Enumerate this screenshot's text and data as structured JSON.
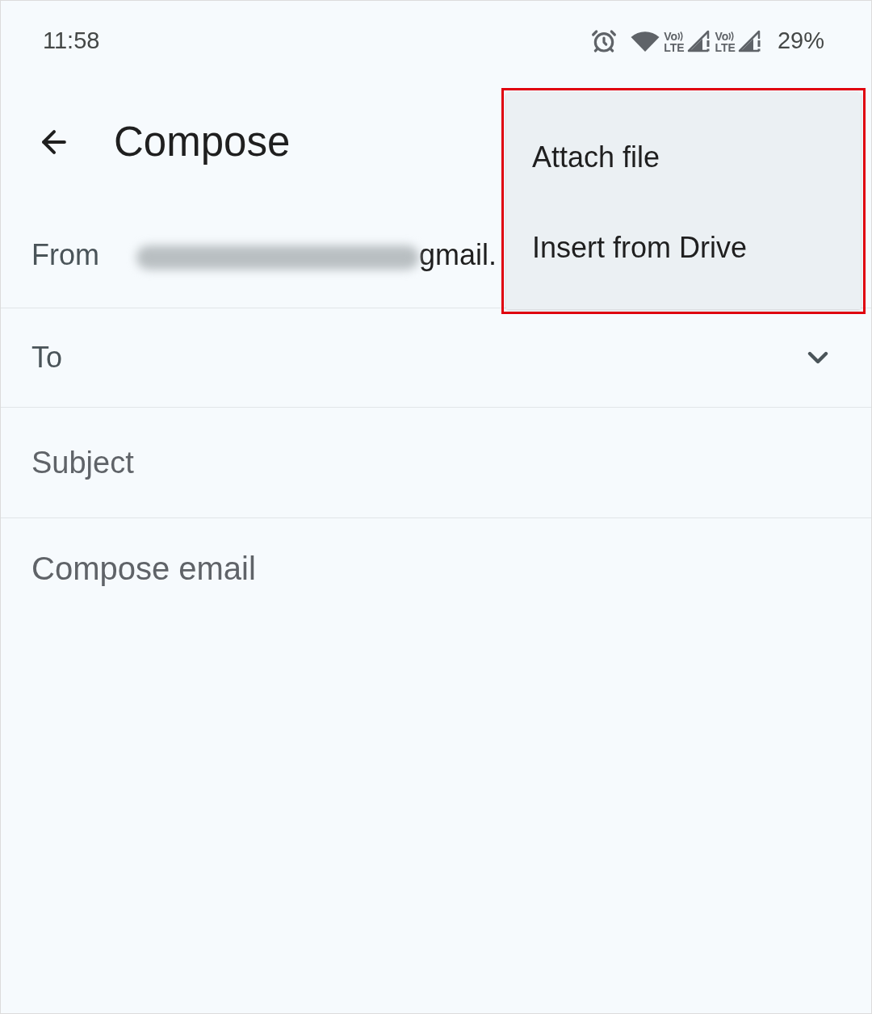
{
  "status_bar": {
    "time": "11:58",
    "sims": [
      {
        "volte_top": "Vo",
        "volte_bottom": "LTE"
      },
      {
        "volte_top": "Vo",
        "volte_bottom": "LTE"
      }
    ],
    "battery": "29%"
  },
  "app_bar": {
    "title": "Compose"
  },
  "fields": [
    {
      "kind": "from",
      "label": "From",
      "value": "gmail."
    },
    {
      "kind": "to",
      "label": "To"
    },
    {
      "kind": "subject",
      "placeholder": "Subject"
    }
  ],
  "body": {
    "placeholder": "Compose email"
  },
  "menu": {
    "highlighted": true,
    "items": [
      {
        "label": "Attach file"
      },
      {
        "label": "Insert from Drive"
      }
    ]
  }
}
